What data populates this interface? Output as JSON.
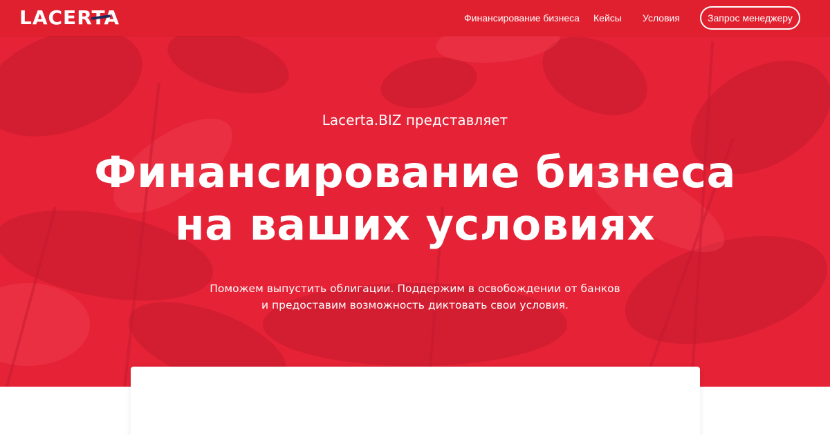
{
  "brand": {
    "logo_text": "LACERTA",
    "accent": "#e52236",
    "navy": "#1b2a5c"
  },
  "nav": {
    "items": [
      {
        "label": "Финансирование бизнеса"
      },
      {
        "label": "Кейсы"
      },
      {
        "label": "Условия"
      }
    ],
    "cta_label": "Запрос менеджеру"
  },
  "hero": {
    "eyebrow": "Lacerta.BIZ представляет",
    "headline_line1": "Финансирование бизнеса",
    "headline_line2": "на ваших условиях",
    "sub_line1": "Поможем выпустить облигации. Поддержим в освобождении от банков",
    "sub_line2": "и предоставим возможность диктовать свои условия."
  },
  "card": {
    "heading_partial": ""
  }
}
